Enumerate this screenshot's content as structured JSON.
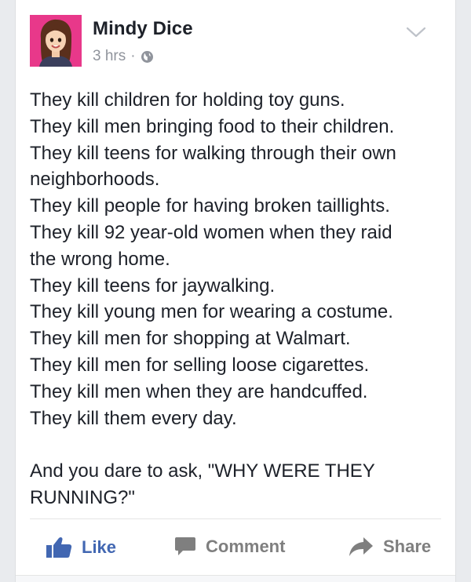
{
  "post": {
    "author": "Mindy Dice",
    "time": "3 hrs",
    "separator": "·",
    "privacy_icon": "globe-icon",
    "menu_icon": "chevron-down-icon",
    "lines": [
      "They kill children for holding toy guns.",
      "They kill men bringing food to their children.",
      "They kill teens for walking through their own",
      "neighborhoods.",
      "They kill people for having broken taillights.",
      "They kill 92 year-old women when they raid",
      "the wrong home.",
      "They kill teens for jaywalking.",
      "They kill young men for wearing a costume.",
      "They kill men for shopping at Walmart.",
      "They kill men for selling loose cigarettes.",
      "They kill men when they are handcuffed.",
      "They kill them every day."
    ],
    "closing_lines": [
      "And you dare to ask, \"WHY WERE THEY",
      "RUNNING?\""
    ]
  },
  "actions": {
    "like": "Like",
    "comment": "Comment",
    "share": "Share"
  },
  "colors": {
    "accent": "#4267b2",
    "avatar_bg": "#e8388a",
    "text": "#1d2129",
    "meta": "#90949c"
  }
}
